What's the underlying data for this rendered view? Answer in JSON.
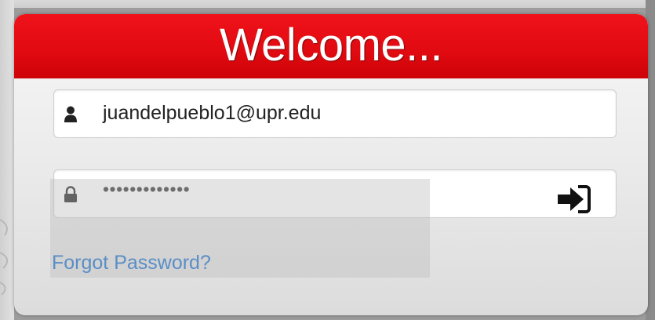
{
  "header": {
    "title": "Welcome..."
  },
  "login": {
    "email": {
      "value": "juandelpueblo1@upr.edu",
      "icon": "user-icon"
    },
    "password": {
      "value": "•••••••••••••",
      "icon": "lock-icon"
    },
    "submit_icon": "sign-in-icon",
    "forgot_password_label": "Forgot Password?"
  },
  "colors": {
    "header_red": "#e00a10",
    "link_blue": "#5a8ec6",
    "panel_bg": "#ececec"
  }
}
